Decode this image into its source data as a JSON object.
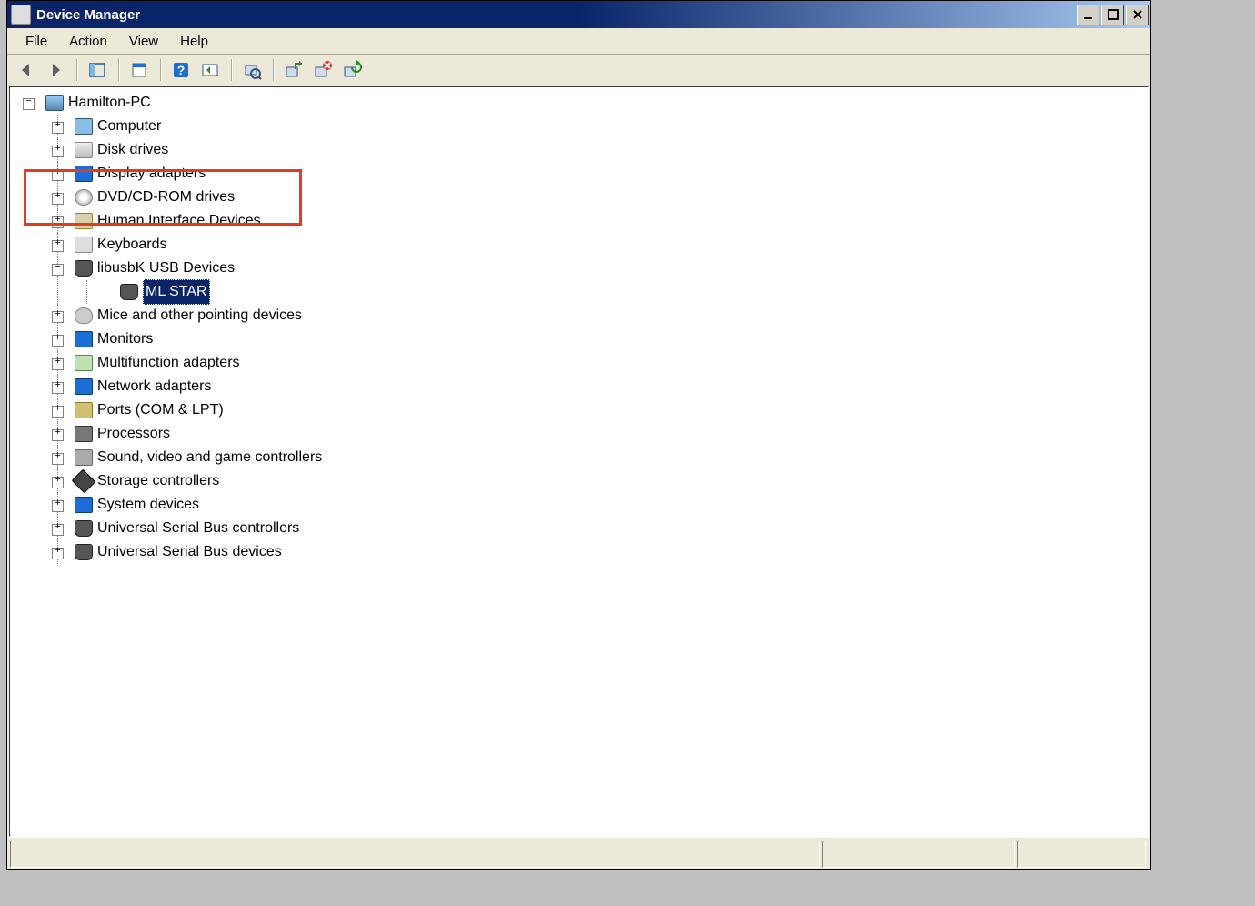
{
  "window": {
    "title": "Device Manager"
  },
  "menu": {
    "file": "File",
    "action": "Action",
    "view": "View",
    "help": "Help"
  },
  "toolbar": {
    "back_icon": "back-arrow",
    "forward_icon": "forward-arrow",
    "show_hide_icon": "console-tree",
    "properties_icon": "properties",
    "help_icon": "help",
    "action_icon": "action",
    "scan_icon": "scan-hardware",
    "enable_icon": "enable-device",
    "disable_icon": "disable-device",
    "update_icon": "update-driver"
  },
  "tree": {
    "root": "Hamilton-PC",
    "nodes": [
      {
        "label": "Computer",
        "icon": "computer"
      },
      {
        "label": "Disk drives",
        "icon": "disk"
      },
      {
        "label": "Display adapters",
        "icon": "display"
      },
      {
        "label": "DVD/CD-ROM drives",
        "icon": "dvd"
      },
      {
        "label": "Human Interface Devices",
        "icon": "hid"
      },
      {
        "label": "Keyboards",
        "icon": "kbd"
      },
      {
        "label": "libusbK USB Devices",
        "icon": "usb",
        "expanded": true,
        "children": [
          {
            "label": "ML STAR",
            "icon": "usb",
            "selected": true
          }
        ]
      },
      {
        "label": "Mice and other pointing devices",
        "icon": "mouse"
      },
      {
        "label": "Monitors",
        "icon": "monitor"
      },
      {
        "label": "Multifunction adapters",
        "icon": "multi"
      },
      {
        "label": "Network adapters",
        "icon": "net"
      },
      {
        "label": "Ports (COM & LPT)",
        "icon": "ports"
      },
      {
        "label": "Processors",
        "icon": "cpu"
      },
      {
        "label": "Sound, video and game controllers",
        "icon": "sound"
      },
      {
        "label": "Storage controllers",
        "icon": "storage"
      },
      {
        "label": "System devices",
        "icon": "sys"
      },
      {
        "label": "Universal Serial Bus controllers",
        "icon": "usb"
      },
      {
        "label": "Universal Serial Bus devices",
        "icon": "usb"
      }
    ]
  },
  "highlight": {
    "note": "red annotation box around libusbK USB Devices / ML STAR"
  }
}
